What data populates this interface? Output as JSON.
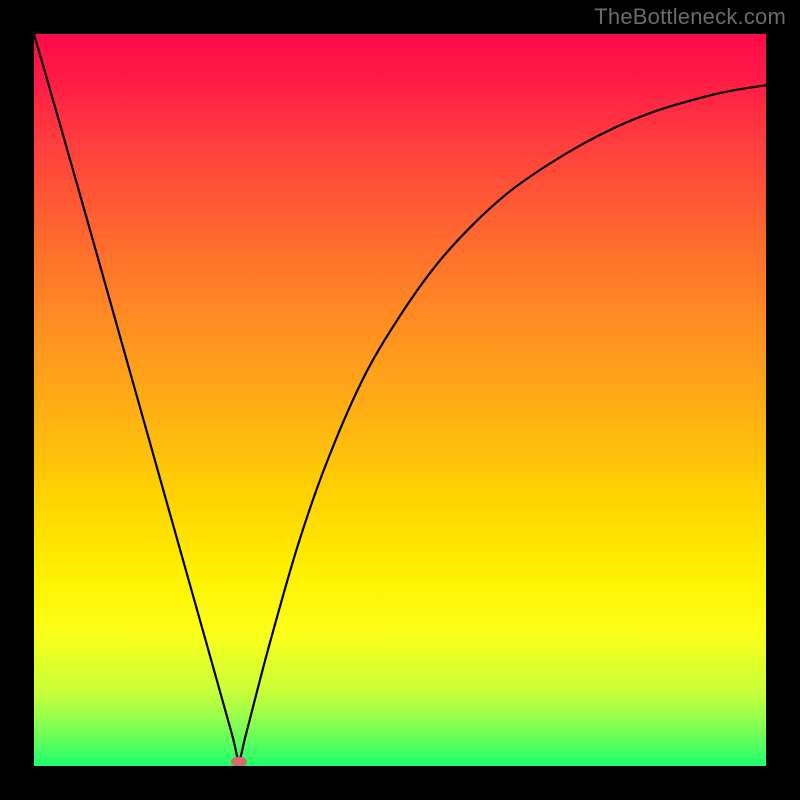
{
  "watermark": "TheBottleneck.com",
  "colors": {
    "curve": "#000000",
    "marker": "#d46a6a",
    "frame": "#000000"
  },
  "chart_data": {
    "type": "line",
    "title": "",
    "xlabel": "",
    "ylabel": "",
    "xlim": [
      0,
      1
    ],
    "ylim": [
      0,
      1
    ],
    "grid": false,
    "legend": false,
    "note": "Axes are unlabeled in the image. x/y normalized to plot box (origin bottom-left). y ≈ bottleneck magnitude; curve touches 0 near x≈0.28.",
    "series": [
      {
        "name": "bottleneck-curve",
        "x": [
          0.0,
          0.04,
          0.08,
          0.12,
          0.16,
          0.2,
          0.24,
          0.27,
          0.28,
          0.29,
          0.32,
          0.36,
          0.4,
          0.45,
          0.5,
          0.55,
          0.6,
          0.65,
          0.7,
          0.75,
          0.8,
          0.85,
          0.9,
          0.95,
          1.0
        ],
        "y": [
          1.0,
          0.861,
          0.72,
          0.578,
          0.436,
          0.294,
          0.152,
          0.045,
          0.01,
          0.045,
          0.16,
          0.3,
          0.415,
          0.53,
          0.615,
          0.685,
          0.74,
          0.785,
          0.82,
          0.85,
          0.875,
          0.895,
          0.91,
          0.922,
          0.93
        ]
      }
    ],
    "marker": {
      "x": 0.28,
      "y": 0.006
    }
  }
}
